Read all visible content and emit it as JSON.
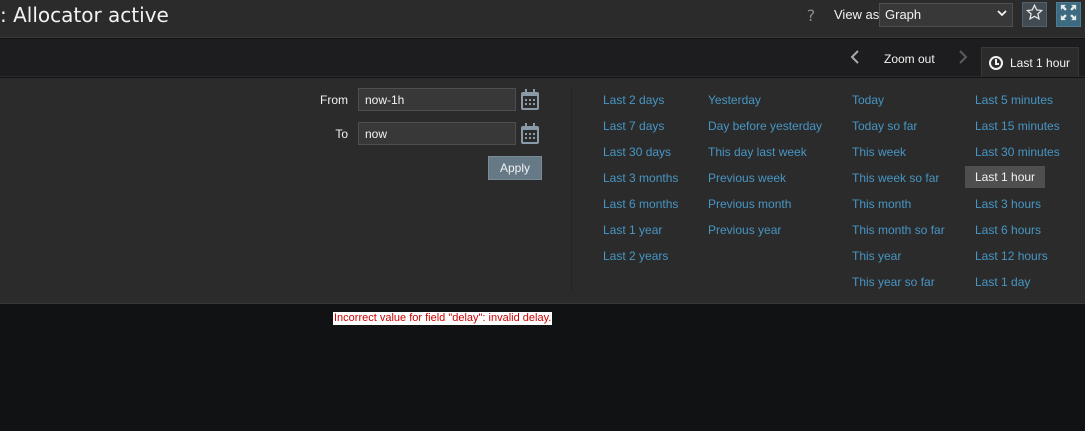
{
  "header": {
    "title": ": Allocator active",
    "help_glyph": "?",
    "view_as_label": "View as",
    "view_as_selected": "Graph",
    "icons": {
      "help": "question-icon",
      "favourite": "star-icon",
      "fullscreen": "fullscreen-icon",
      "dropdown": "chevron-down-icon"
    }
  },
  "tabbar": {
    "prev_glyph": "‹",
    "zoom_out_label": "Zoom out",
    "next_glyph": "›",
    "time_tab_label": "Last 1 hour",
    "icons": {
      "prev": "chevron-left-icon",
      "next": "chevron-right-icon",
      "clock": "clock-icon"
    }
  },
  "filter": {
    "from_label": "From",
    "from_value": "now-1h",
    "to_label": "To",
    "to_value": "now",
    "apply_label": "Apply",
    "calendar_icon": "calendar-icon"
  },
  "quick_ranges": {
    "col1": [
      "Last 2 days",
      "Last 7 days",
      "Last 30 days",
      "Last 3 months",
      "Last 6 months",
      "Last 1 year",
      "Last 2 years"
    ],
    "col2": [
      "Yesterday",
      "Day before yesterday",
      "This day last week",
      "Previous week",
      "Previous month",
      "Previous year"
    ],
    "col3": [
      "Today",
      "Today so far",
      "This week",
      "This week so far",
      "This month",
      "This month so far",
      "This year",
      "This year so far"
    ],
    "col4": [
      "Last 5 minutes",
      "Last 15 minutes",
      "Last 30 minutes",
      "Last 1 hour",
      "Last 3 hours",
      "Last 6 hours",
      "Last 12 hours",
      "Last 1 day"
    ],
    "selected": "Last 1 hour"
  },
  "error_message": "Incorrect value for field \"delay\": invalid delay.",
  "colors": {
    "background": "#111214",
    "panel": "#2b2b2b",
    "link": "#4796c4",
    "button": "#667986",
    "error_text": "#cc0000"
  }
}
